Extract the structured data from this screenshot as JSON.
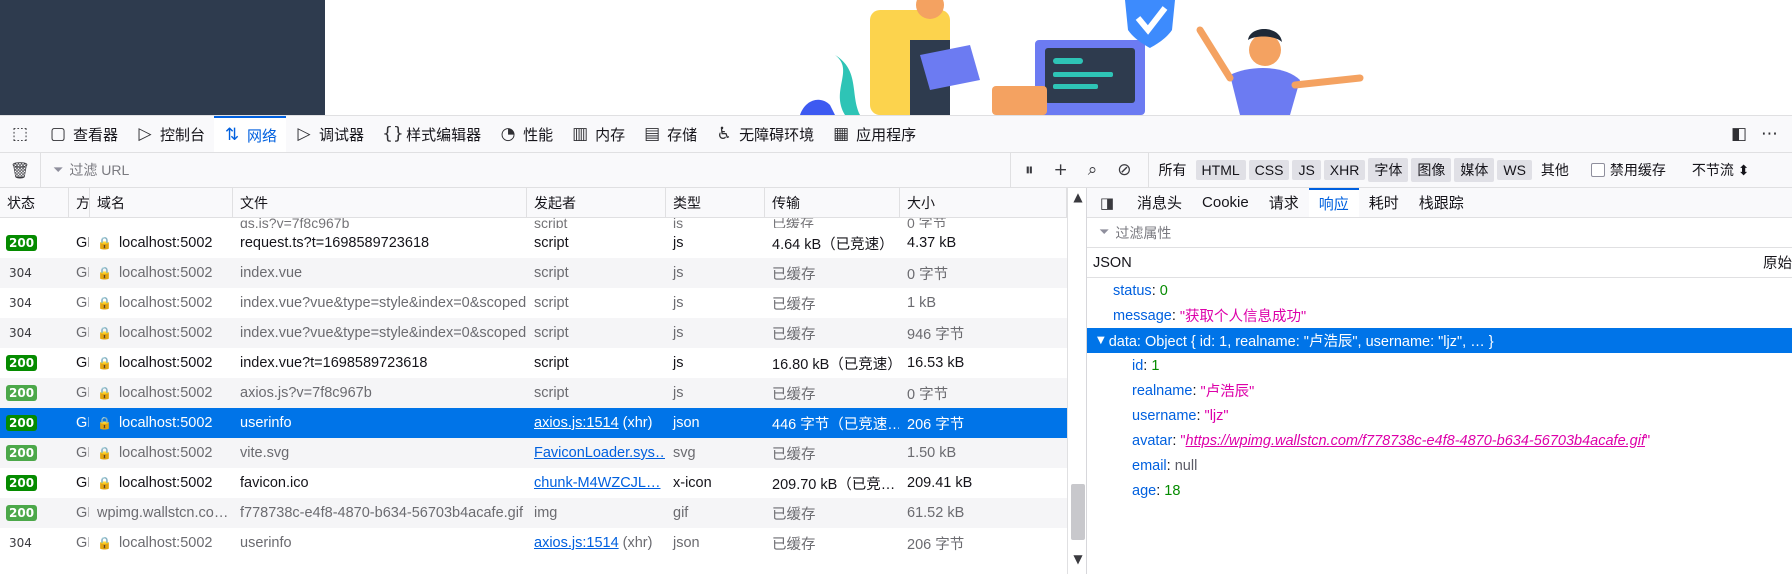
{
  "devtools_tabs": [
    {
      "label": "查看器",
      "icon": "inspector-icon"
    },
    {
      "label": "控制台",
      "icon": "console-icon"
    },
    {
      "label": "网络",
      "icon": "network-icon",
      "active": true
    },
    {
      "label": "调试器",
      "icon": "debugger-icon"
    },
    {
      "label": "样式编辑器",
      "icon": "style-editor-icon"
    },
    {
      "label": "性能",
      "icon": "performance-icon"
    },
    {
      "label": "内存",
      "icon": "memory-icon"
    },
    {
      "label": "存储",
      "icon": "storage-icon"
    },
    {
      "label": "无障碍环境",
      "icon": "accessibility-icon"
    },
    {
      "label": "应用程序",
      "icon": "application-icon"
    }
  ],
  "toolbar": {
    "filter_placeholder": "过滤 URL",
    "type_filters": [
      {
        "label": "所有",
        "on": false
      },
      {
        "label": "HTML",
        "on": true
      },
      {
        "label": "CSS",
        "on": true
      },
      {
        "label": "JS",
        "on": true
      },
      {
        "label": "XHR",
        "on": true
      },
      {
        "label": "字体",
        "on": true
      },
      {
        "label": "图像",
        "on": true
      },
      {
        "label": "媒体",
        "on": true
      },
      {
        "label": "WS",
        "on": true
      },
      {
        "label": "其他",
        "on": false
      }
    ],
    "disable_cache_label": "禁用缓存",
    "throttle_label": "不节流 ⬍"
  },
  "table": {
    "headers": {
      "status": "状态",
      "method": "方",
      "domain": "域名",
      "file": "文件",
      "initiator": "发起者",
      "type": "类型",
      "transferred": "传输",
      "size": "大小"
    },
    "partial_row": {
      "file": "qs.js?v=7f8c967b",
      "initiator": "script",
      "type": "js",
      "transferred": "已缓存",
      "size": "0 字节"
    },
    "rows": [
      {
        "status": "200",
        "method": "GI",
        "domain": "localhost:5002",
        "file": "request.ts?t=1698589723618",
        "initiator": "script",
        "type": "js",
        "transferred": "4.64 kB（已竞速）",
        "size": "4.37 kB"
      },
      {
        "status": "304",
        "method": "GI",
        "domain": "localhost:5002",
        "file": "index.vue",
        "initiator": "script",
        "type": "js",
        "transferred": "已缓存",
        "size": "0 字节"
      },
      {
        "status": "304",
        "method": "GI",
        "domain": "localhost:5002",
        "file": "index.vue?vue&type=style&index=0&scoped",
        "initiator": "script",
        "type": "js",
        "transferred": "已缓存",
        "size": "1 kB"
      },
      {
        "status": "304",
        "method": "GI",
        "domain": "localhost:5002",
        "file": "index.vue?vue&type=style&index=0&scoped",
        "initiator": "script",
        "type": "js",
        "transferred": "已缓存",
        "size": "946 字节"
      },
      {
        "status": "200",
        "method": "GI",
        "domain": "localhost:5002",
        "file": "index.vue?t=1698589723618",
        "initiator": "script",
        "type": "js",
        "transferred": "16.80 kB（已竞速）",
        "size": "16.53 kB"
      },
      {
        "status": "200",
        "method": "GI",
        "domain": "localhost:5002",
        "file": "axios.js?v=7f8c967b",
        "initiator": "script",
        "type": "js",
        "transferred": "已缓存",
        "size": "0 字节"
      },
      {
        "status": "200",
        "method": "GI",
        "domain": "localhost:5002",
        "file": "userinfo",
        "initiator": "axios.js:1514",
        "initiator_extra": "(xhr)",
        "type": "json",
        "transferred": "446 字节（已竞速…",
        "size": "206 字节",
        "selected": true
      },
      {
        "status": "200",
        "method": "GI",
        "domain": "localhost:5002",
        "file": "vite.svg",
        "initiator": "FaviconLoader.sys…",
        "type": "svg",
        "transferred": "已缓存",
        "size": "1.50 kB"
      },
      {
        "status": "200",
        "method": "GI",
        "domain": "localhost:5002",
        "file": "favicon.ico",
        "initiator": "chunk-M4WZCJL…",
        "type": "x-icon",
        "transferred": "209.70 kB（已竞…",
        "size": "209.41 kB"
      },
      {
        "status": "200",
        "method": "GI",
        "domain": "wpimg.wallstcn.co…",
        "file": "f778738c-e4f8-4870-b634-56703b4acafe.gif",
        "initiator": "img",
        "type": "gif",
        "transferred": "已缓存",
        "size": "61.52 kB"
      },
      {
        "status": "304",
        "method": "GI",
        "domain": "localhost:5002",
        "file": "userinfo",
        "initiator": "axios.js:1514",
        "initiator_extra": "(xhr)",
        "type": "json",
        "transferred": "已缓存",
        "size": "206 字节"
      }
    ]
  },
  "details": {
    "tabs": [
      {
        "label": "消息头"
      },
      {
        "label": "Cookie"
      },
      {
        "label": "请求"
      },
      {
        "label": "响应",
        "active": true
      },
      {
        "label": "耗时"
      },
      {
        "label": "栈跟踪"
      }
    ],
    "filter_placeholder": "过滤属性",
    "json_label": "JSON",
    "raw_label": "原始",
    "json": {
      "status_key": "status",
      "status_val": "0",
      "message_key": "message",
      "message_val": "\"获取个人信息成功\"",
      "data_summary": "data: Object { id: 1, realname: \"卢浩辰\", username: \"ljz\", … }",
      "id_key": "id",
      "id_val": "1",
      "realname_key": "realname",
      "realname_val": "\"卢浩辰\"",
      "username_key": "username",
      "username_val": "\"ljz\"",
      "avatar_key": "avatar",
      "avatar_q1": "\"",
      "avatar_val": "https://wpimg.wallstcn.com/f778738c-e4f8-4870-b634-56703b4acafe.gif",
      "avatar_q2": "\"",
      "email_key": "email",
      "email_val": "null",
      "age_key": "age",
      "age_val": "18"
    }
  },
  "colors": {
    "accent": "#0060df",
    "selection": "#0074e8",
    "ok_badge": "#058b00"
  }
}
